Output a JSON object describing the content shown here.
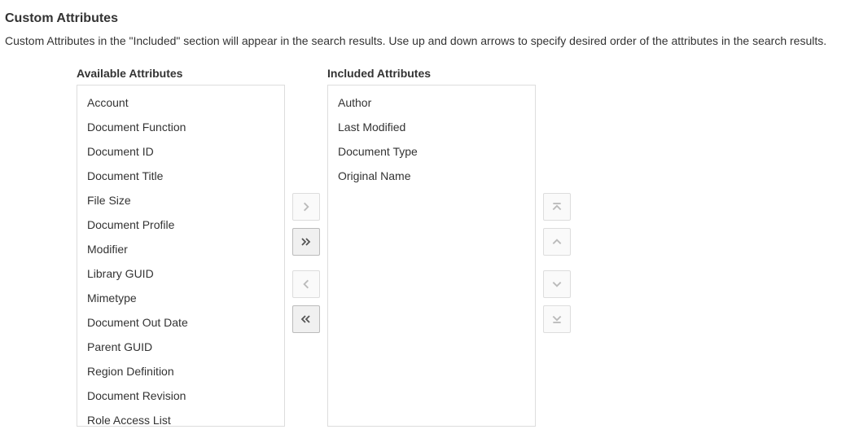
{
  "page": {
    "title": "Custom Attributes",
    "description": "Custom Attributes in the \"Included\" section will appear in the search results. Use up and down arrows to specify desired order of the attributes in the search results."
  },
  "available": {
    "title": "Available Attributes",
    "items": [
      "Account",
      "Document Function",
      "Document ID",
      "Document Title",
      "File Size",
      "Document Profile",
      "Modifier",
      "Library GUID",
      "Mimetype",
      "Document Out Date",
      "Parent GUID",
      "Region Definition",
      "Document Revision",
      "Role Access List"
    ]
  },
  "included": {
    "title": "Included Attributes",
    "items": [
      "Author",
      "Last Modified",
      "Document Type",
      "Original Name"
    ]
  }
}
